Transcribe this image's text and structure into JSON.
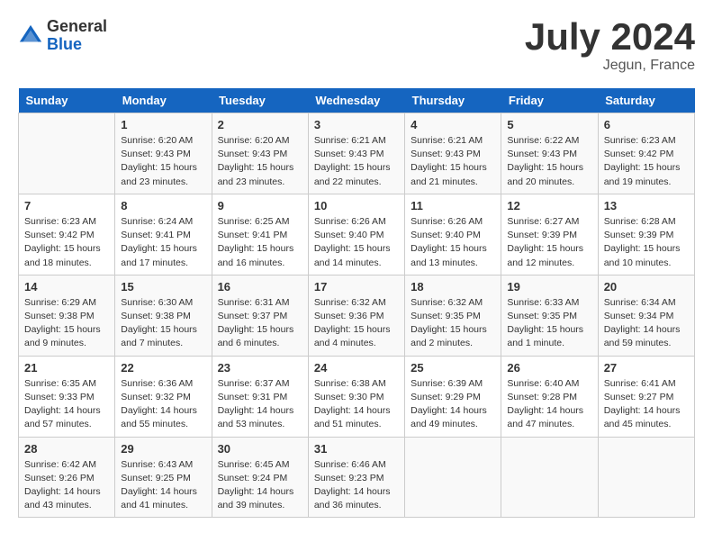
{
  "header": {
    "logo_general": "General",
    "logo_blue": "Blue",
    "month_title": "July 2024",
    "location": "Jegun, France"
  },
  "days_of_week": [
    "Sunday",
    "Monday",
    "Tuesday",
    "Wednesday",
    "Thursday",
    "Friday",
    "Saturday"
  ],
  "weeks": [
    [
      {
        "day": "",
        "info": ""
      },
      {
        "day": "1",
        "info": "Sunrise: 6:20 AM\nSunset: 9:43 PM\nDaylight: 15 hours\nand 23 minutes."
      },
      {
        "day": "2",
        "info": "Sunrise: 6:20 AM\nSunset: 9:43 PM\nDaylight: 15 hours\nand 23 minutes."
      },
      {
        "day": "3",
        "info": "Sunrise: 6:21 AM\nSunset: 9:43 PM\nDaylight: 15 hours\nand 22 minutes."
      },
      {
        "day": "4",
        "info": "Sunrise: 6:21 AM\nSunset: 9:43 PM\nDaylight: 15 hours\nand 21 minutes."
      },
      {
        "day": "5",
        "info": "Sunrise: 6:22 AM\nSunset: 9:43 PM\nDaylight: 15 hours\nand 20 minutes."
      },
      {
        "day": "6",
        "info": "Sunrise: 6:23 AM\nSunset: 9:42 PM\nDaylight: 15 hours\nand 19 minutes."
      }
    ],
    [
      {
        "day": "7",
        "info": "Sunrise: 6:23 AM\nSunset: 9:42 PM\nDaylight: 15 hours\nand 18 minutes."
      },
      {
        "day": "8",
        "info": "Sunrise: 6:24 AM\nSunset: 9:41 PM\nDaylight: 15 hours\nand 17 minutes."
      },
      {
        "day": "9",
        "info": "Sunrise: 6:25 AM\nSunset: 9:41 PM\nDaylight: 15 hours\nand 16 minutes."
      },
      {
        "day": "10",
        "info": "Sunrise: 6:26 AM\nSunset: 9:40 PM\nDaylight: 15 hours\nand 14 minutes."
      },
      {
        "day": "11",
        "info": "Sunrise: 6:26 AM\nSunset: 9:40 PM\nDaylight: 15 hours\nand 13 minutes."
      },
      {
        "day": "12",
        "info": "Sunrise: 6:27 AM\nSunset: 9:39 PM\nDaylight: 15 hours\nand 12 minutes."
      },
      {
        "day": "13",
        "info": "Sunrise: 6:28 AM\nSunset: 9:39 PM\nDaylight: 15 hours\nand 10 minutes."
      }
    ],
    [
      {
        "day": "14",
        "info": "Sunrise: 6:29 AM\nSunset: 9:38 PM\nDaylight: 15 hours\nand 9 minutes."
      },
      {
        "day": "15",
        "info": "Sunrise: 6:30 AM\nSunset: 9:38 PM\nDaylight: 15 hours\nand 7 minutes."
      },
      {
        "day": "16",
        "info": "Sunrise: 6:31 AM\nSunset: 9:37 PM\nDaylight: 15 hours\nand 6 minutes."
      },
      {
        "day": "17",
        "info": "Sunrise: 6:32 AM\nSunset: 9:36 PM\nDaylight: 15 hours\nand 4 minutes."
      },
      {
        "day": "18",
        "info": "Sunrise: 6:32 AM\nSunset: 9:35 PM\nDaylight: 15 hours\nand 2 minutes."
      },
      {
        "day": "19",
        "info": "Sunrise: 6:33 AM\nSunset: 9:35 PM\nDaylight: 15 hours\nand 1 minute."
      },
      {
        "day": "20",
        "info": "Sunrise: 6:34 AM\nSunset: 9:34 PM\nDaylight: 14 hours\nand 59 minutes."
      }
    ],
    [
      {
        "day": "21",
        "info": "Sunrise: 6:35 AM\nSunset: 9:33 PM\nDaylight: 14 hours\nand 57 minutes."
      },
      {
        "day": "22",
        "info": "Sunrise: 6:36 AM\nSunset: 9:32 PM\nDaylight: 14 hours\nand 55 minutes."
      },
      {
        "day": "23",
        "info": "Sunrise: 6:37 AM\nSunset: 9:31 PM\nDaylight: 14 hours\nand 53 minutes."
      },
      {
        "day": "24",
        "info": "Sunrise: 6:38 AM\nSunset: 9:30 PM\nDaylight: 14 hours\nand 51 minutes."
      },
      {
        "day": "25",
        "info": "Sunrise: 6:39 AM\nSunset: 9:29 PM\nDaylight: 14 hours\nand 49 minutes."
      },
      {
        "day": "26",
        "info": "Sunrise: 6:40 AM\nSunset: 9:28 PM\nDaylight: 14 hours\nand 47 minutes."
      },
      {
        "day": "27",
        "info": "Sunrise: 6:41 AM\nSunset: 9:27 PM\nDaylight: 14 hours\nand 45 minutes."
      }
    ],
    [
      {
        "day": "28",
        "info": "Sunrise: 6:42 AM\nSunset: 9:26 PM\nDaylight: 14 hours\nand 43 minutes."
      },
      {
        "day": "29",
        "info": "Sunrise: 6:43 AM\nSunset: 9:25 PM\nDaylight: 14 hours\nand 41 minutes."
      },
      {
        "day": "30",
        "info": "Sunrise: 6:45 AM\nSunset: 9:24 PM\nDaylight: 14 hours\nand 39 minutes."
      },
      {
        "day": "31",
        "info": "Sunrise: 6:46 AM\nSunset: 9:23 PM\nDaylight: 14 hours\nand 36 minutes."
      },
      {
        "day": "",
        "info": ""
      },
      {
        "day": "",
        "info": ""
      },
      {
        "day": "",
        "info": ""
      }
    ]
  ]
}
